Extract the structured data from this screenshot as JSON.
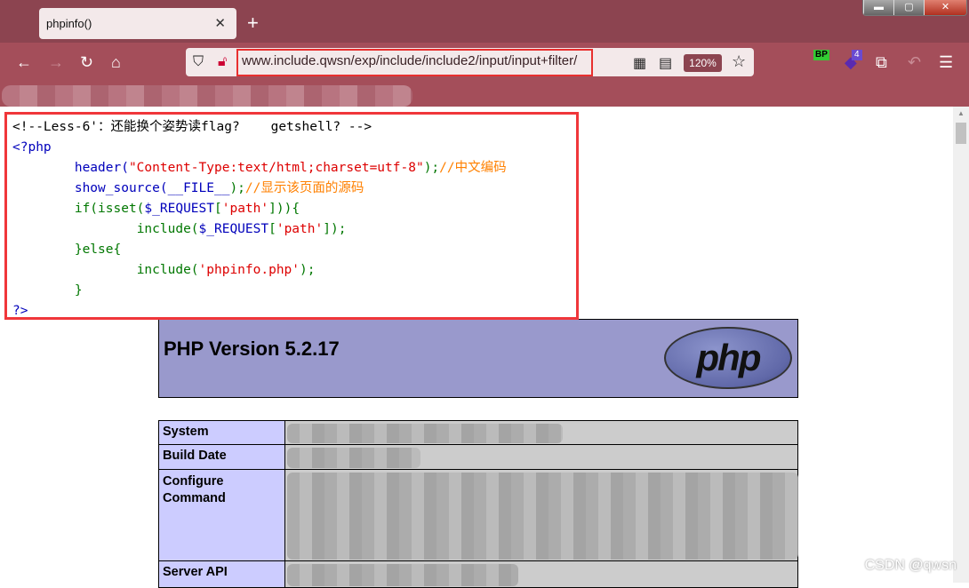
{
  "browser": {
    "tab_title": "phpinfo()",
    "tab_close": "✕",
    "new_tab": "+",
    "url": "www.include.qwsn/exp/include/include2/input/input+filter/",
    "zoom_level": "120%",
    "extension_badge_bp": "BP",
    "extension_badge_count": "4",
    "accent_color": "#a44e5a"
  },
  "code": {
    "comment_line": "<!--Less-6'：还能换个姿势读flag?    getshell? -->",
    "open_tag": "<?php",
    "l1_fn": "header(",
    "l1_str": "\"Content-Type:text/html;charset=utf-8\"",
    "l1_end": ");",
    "l1_comment": "//中文编码",
    "l2_fn": "show_source(",
    "l2_const": "__FILE__",
    "l2_end": ");",
    "l2_comment": "//显示该页面的源码",
    "l3_a": "if(isset(",
    "l3_var": "$_REQUEST",
    "l3_b": "[",
    "l3_key": "'path'",
    "l3_c": "])){",
    "l4_a": "include(",
    "l4_var": "$_REQUEST",
    "l4_b": "[",
    "l4_key": "'path'",
    "l4_c": "]);",
    "l5": "}else{",
    "l6_a": "include(",
    "l6_str": "'phpinfo.php'",
    "l6_c": ");",
    "l7": "}",
    "close_tag": "?>"
  },
  "phpinfo": {
    "version": "PHP Version 5.2.17",
    "logo_text": "php",
    "rows": [
      {
        "key": "System"
      },
      {
        "key": "Build Date"
      },
      {
        "key": "Configure Command"
      },
      {
        "key": "Server API"
      }
    ]
  },
  "watermark": "CSDN @qwsn"
}
